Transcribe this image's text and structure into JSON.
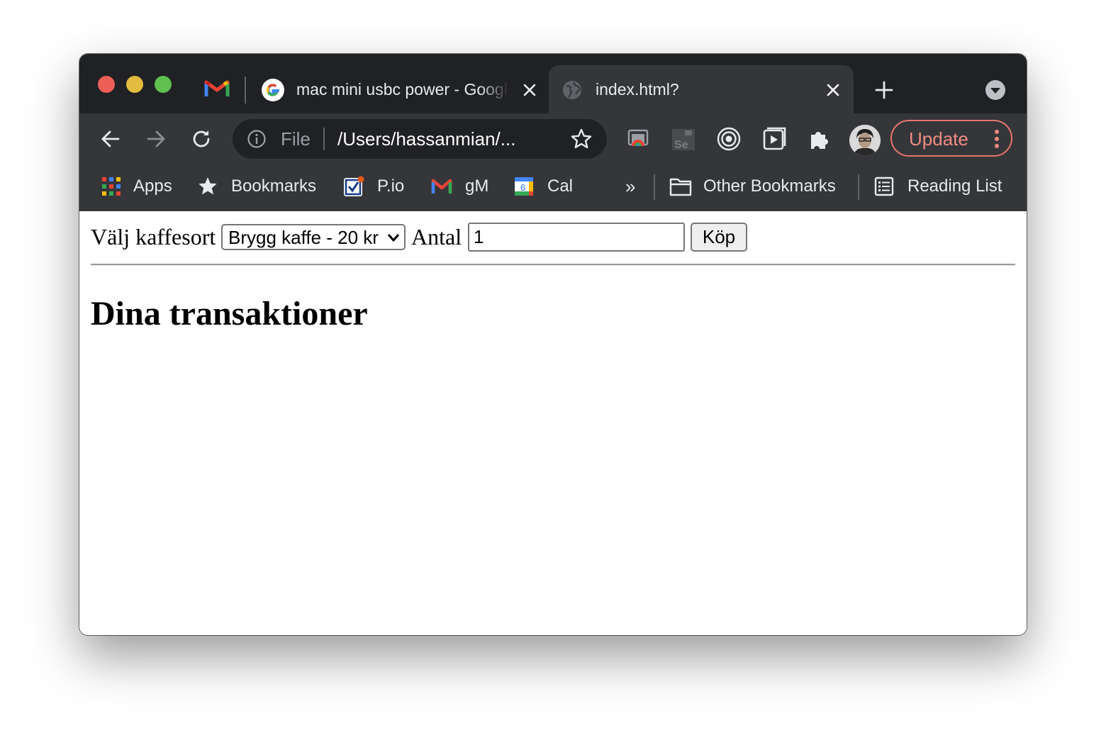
{
  "browser": {
    "tabs": [
      {
        "title": "mac mini usbc power - Google",
        "active": false,
        "icon": "google-g-icon"
      },
      {
        "title": "index.html?",
        "active": true,
        "icon": "globe-icon"
      }
    ],
    "pinned_tab_icon": "gmail-icon",
    "omnibox": {
      "scheme": "File",
      "url": "/Users/hassanmian/..."
    },
    "update_label": "Update",
    "bookmarks": [
      {
        "label": "Apps",
        "icon": "apps-grid-icon"
      },
      {
        "label": "Bookmarks",
        "icon": "star-icon"
      },
      {
        "label": "P.io",
        "icon": "checkbox-app-icon"
      },
      {
        "label": "gM",
        "icon": "gmail-icon"
      },
      {
        "label": "Cal",
        "icon": "calendar-icon"
      }
    ],
    "overflow_chevron": "»",
    "other_bookmarks": "Other Bookmarks",
    "reading_list": "Reading List",
    "calendar_day": "6"
  },
  "page": {
    "coffee_label": "Välj kaffesort",
    "coffee_selected": "Brygg kaffe - 20 kr",
    "quantity_label": "Antal",
    "quantity_value": "1",
    "buy_button": "Köp",
    "heading": "Dina transaktioner"
  },
  "colors": {
    "tabstrip_bg": "#202124",
    "toolbar_bg": "#35363a",
    "update_accent": "#f28b82"
  }
}
